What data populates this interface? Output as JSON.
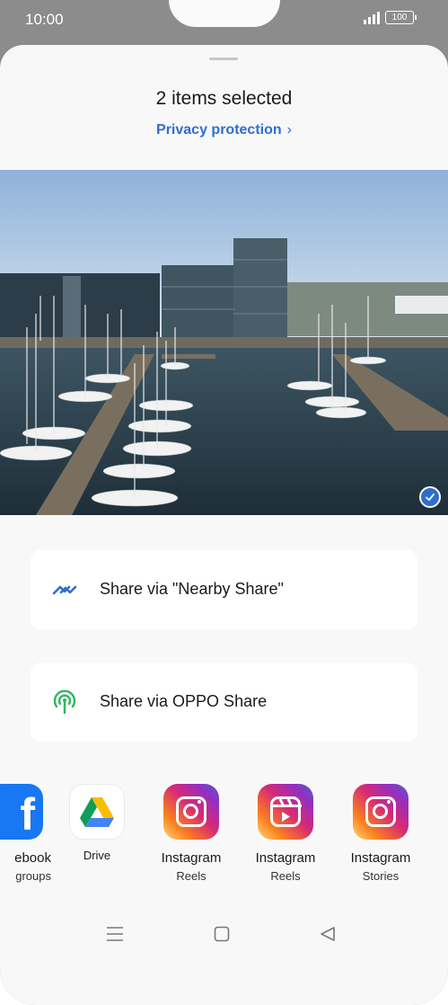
{
  "status_bar": {
    "time": "10:00",
    "battery": "100"
  },
  "sheet": {
    "title": "2 items selected",
    "privacy_link": "Privacy protection",
    "privacy_chevron": "›"
  },
  "photo": {
    "selected": true,
    "check_icon": "checkmark-icon"
  },
  "share_options": [
    {
      "label": "Share via \"Nearby Share\"",
      "icon": "nearby-share-icon",
      "color": "#2f6ecf"
    },
    {
      "label": "Share via OPPO Share",
      "icon": "oppo-share-icon",
      "color": "#2fb55f"
    }
  ],
  "apps": [
    {
      "name": "ebook",
      "sub": "groups",
      "icon": "facebook-icon"
    },
    {
      "name": "Drive",
      "sub": "",
      "icon": "google-drive-icon"
    },
    {
      "name": "Instagram",
      "sub": "Reels",
      "icon": "instagram-icon"
    },
    {
      "name": "Instagram",
      "sub": "Reels",
      "icon": "instagram-reels-icon"
    },
    {
      "name": "Instagram",
      "sub": "Stories",
      "icon": "instagram-icon"
    }
  ],
  "colors": {
    "accent": "#2f6ecf",
    "sheet_bg": "#f8f8f8",
    "oppo_green": "#2fb55f"
  }
}
